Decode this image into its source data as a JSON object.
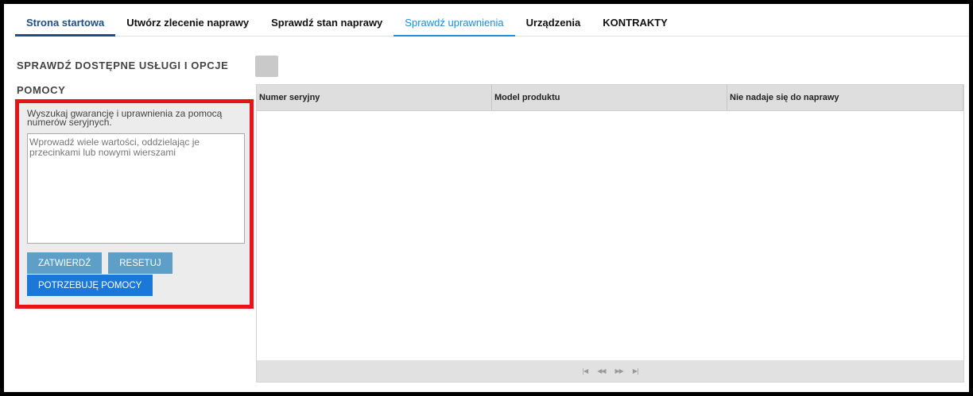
{
  "nav": {
    "tabs": [
      {
        "label": "Strona startowa"
      },
      {
        "label": "Utwórz zlecenie naprawy"
      },
      {
        "label": "Sprawdź stan naprawy"
      },
      {
        "label": "Sprawdź uprawnienia"
      },
      {
        "label": "Urządzenia"
      },
      {
        "label": "KONTRAKTY"
      }
    ],
    "active_tab": "Sprawdź uprawnienia"
  },
  "left_panel": {
    "title": "SPRAWDŹ DOSTĘPNE USŁUGI I OPCJE POMOCY",
    "help_text": "Wyszukaj gwarancję i uprawnienia za pomocą numerów seryjnych.",
    "textarea_placeholder": "Wprowadź wiele wartości, oddzielając je przecinkami lub nowymi wierszami",
    "submit_label": "ZATWIERDŹ",
    "reset_label": "RESETUJ",
    "help_button_label": "POTRZEBUJĘ POMOCY"
  },
  "grid": {
    "columns": [
      "Numer seryjny",
      "Model produktu",
      "Nie nadaje się do naprawy"
    ],
    "rows": [],
    "pager_icons": [
      "first-page-icon",
      "prev-page-icon",
      "next-page-icon",
      "last-page-icon"
    ]
  },
  "colors": {
    "accent": "#1b8fe0",
    "highlight_border": "#e8141b",
    "primary_button": "#1b78d8",
    "secondary_button": "#5d9fc7"
  }
}
